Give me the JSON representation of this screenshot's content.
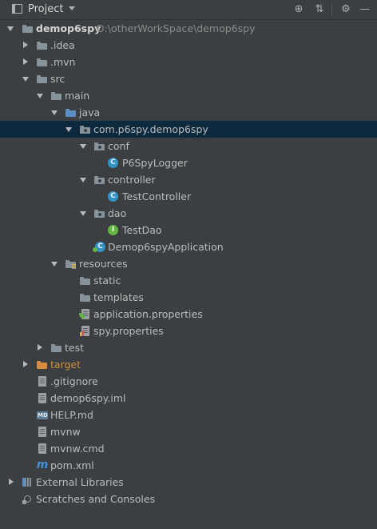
{
  "panel": {
    "title": "Project",
    "toolbar_icons": [
      "locate-icon",
      "collapse-all-icon",
      "settings-icon",
      "hide-icon"
    ]
  },
  "tree": {
    "project_name": "demop6spy",
    "project_path": "D:\\otherWorkSpace\\demop6spy",
    "items": [
      {
        "label": ".idea",
        "icon": "folder-icon",
        "state": "collapsed"
      },
      {
        "label": ".mvn",
        "icon": "folder-icon",
        "state": "collapsed"
      },
      {
        "label": "src",
        "icon": "folder-icon",
        "state": "expanded"
      },
      {
        "label": "main",
        "icon": "folder-icon",
        "state": "expanded"
      },
      {
        "label": "java",
        "icon": "source-folder-icon",
        "state": "expanded"
      },
      {
        "label": "com.p6spy.demop6spy",
        "icon": "package-icon",
        "state": "expanded",
        "selected": true
      },
      {
        "label": "conf",
        "icon": "package-icon",
        "state": "expanded"
      },
      {
        "label": "P6SpyLogger",
        "icon": "class-icon"
      },
      {
        "label": "controller",
        "icon": "package-icon",
        "state": "expanded"
      },
      {
        "label": "TestController",
        "icon": "class-icon"
      },
      {
        "label": "dao",
        "icon": "package-icon",
        "state": "expanded"
      },
      {
        "label": "TestDao",
        "icon": "interface-icon"
      },
      {
        "label": "Demop6spyApplication",
        "icon": "spring-boot-class-icon"
      },
      {
        "label": "resources",
        "icon": "resources-folder-icon",
        "state": "expanded"
      },
      {
        "label": "static",
        "icon": "folder-icon"
      },
      {
        "label": "templates",
        "icon": "folder-icon"
      },
      {
        "label": "application.properties",
        "icon": "spring-properties-icon"
      },
      {
        "label": "spy.properties",
        "icon": "properties-file-icon"
      },
      {
        "label": "test",
        "icon": "folder-icon",
        "state": "collapsed"
      },
      {
        "label": "target",
        "icon": "excluded-folder-icon",
        "state": "collapsed"
      },
      {
        "label": ".gitignore",
        "icon": "text-file-icon"
      },
      {
        "label": "demop6spy.iml",
        "icon": "iml-file-icon"
      },
      {
        "label": "HELP.md",
        "icon": "markdown-file-icon"
      },
      {
        "label": "mvnw",
        "icon": "text-file-icon"
      },
      {
        "label": "mvnw.cmd",
        "icon": "text-file-icon"
      },
      {
        "label": "pom.xml",
        "icon": "maven-icon"
      }
    ],
    "external_libraries": "External Libraries",
    "scratches": "Scratches and Consoles"
  },
  "md_badge": "MD",
  "maven_glyph": "m",
  "class_glyph": "C",
  "interface_glyph": "I",
  "colors": {
    "background": "#3c3f41",
    "selection": "#0d293e",
    "excluded": "#d08e3e",
    "source_folder": "#5b8ec2"
  }
}
